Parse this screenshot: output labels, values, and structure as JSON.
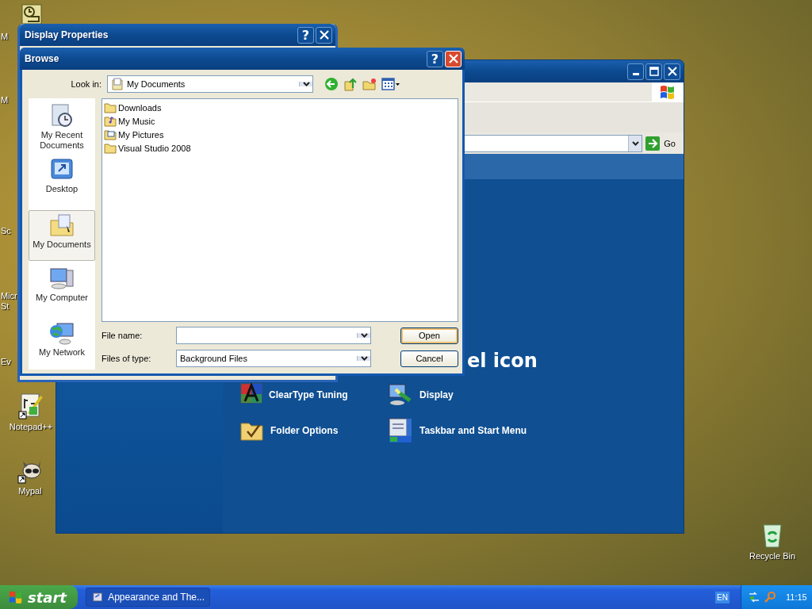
{
  "desktop": {
    "covered_labels": [
      "M",
      "M",
      "Sc",
      "Micr",
      "St",
      "Ev"
    ],
    "icons": [
      {
        "label": "Notepad++",
        "kind": "notepad"
      },
      {
        "label": "Mypal",
        "kind": "mypal"
      },
      {
        "label": "Recycle Bin",
        "kind": "recycle"
      }
    ]
  },
  "control_panel": {
    "go_button": "Go",
    "heading": "el icon",
    "items": [
      {
        "label": "ClearType Tuning",
        "kind": "cleartype"
      },
      {
        "label": "Display",
        "kind": "display"
      },
      {
        "label": "Folder Options",
        "kind": "folder"
      },
      {
        "label": "Taskbar and Start Menu",
        "kind": "taskbar"
      }
    ]
  },
  "display_properties": {
    "title": "Display Properties",
    "help_button": "?"
  },
  "browse": {
    "title": "Browse",
    "help_button": "?",
    "look_in_label": "Look in:",
    "look_in_value": "My Documents",
    "places": [
      {
        "label": "My Recent Documents",
        "kind": "recent",
        "selected": false
      },
      {
        "label": "Desktop",
        "kind": "desktop",
        "selected": false
      },
      {
        "label": "My Documents",
        "kind": "documents",
        "selected": true
      },
      {
        "label": "My Computer",
        "kind": "computer",
        "selected": false
      },
      {
        "label": "My Network",
        "kind": "network",
        "selected": false
      }
    ],
    "files": [
      {
        "name": "Downloads",
        "kind": "folder"
      },
      {
        "name": "My Music",
        "kind": "music"
      },
      {
        "name": "My Pictures",
        "kind": "pictures"
      },
      {
        "name": "Visual Studio 2008",
        "kind": "folder"
      }
    ],
    "file_name_label": "File name:",
    "files_of_type_label": "Files of type:",
    "files_of_type_value": "Background Files",
    "buttons": [
      "Open",
      "Cancel"
    ]
  },
  "taskbar": {
    "start": "start",
    "tasks": [
      "Appearance and The..."
    ],
    "language": "EN",
    "clock": "11:15"
  }
}
